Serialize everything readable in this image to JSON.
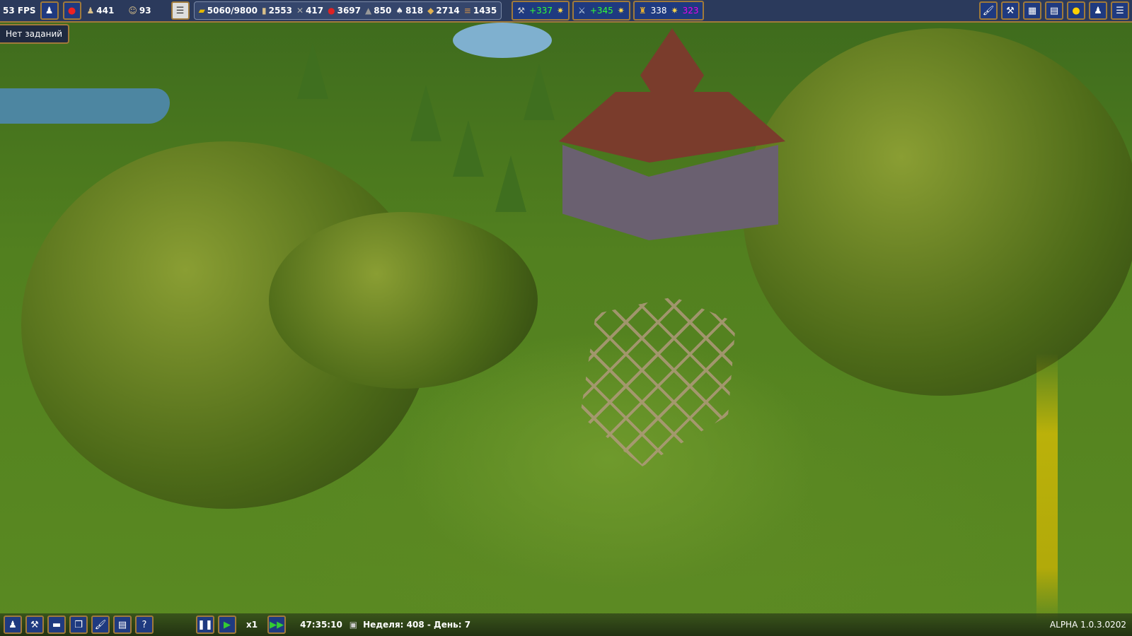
{
  "topbar": {
    "fps": "53 FPS",
    "population": "441",
    "happiness": "93",
    "resources": [
      {
        "icon": "gold-icon",
        "value": "5060/9800"
      },
      {
        "icon": "wood-icon",
        "value": "2553"
      },
      {
        "icon": "tools-icon",
        "value": "417"
      },
      {
        "icon": "berries-icon",
        "value": "3697"
      },
      {
        "icon": "stone-icon",
        "value": "850"
      },
      {
        "icon": "clothes-icon",
        "value": "818"
      },
      {
        "icon": "bread-icon",
        "value": "2714"
      },
      {
        "icon": "planks-icon",
        "value": "1435"
      }
    ],
    "bonuses": [
      {
        "icon": "hammer-icon",
        "value": "+337"
      },
      {
        "icon": "swords-icon",
        "value": "+345"
      },
      {
        "icon": "faith-icon",
        "value": "338",
        "extra": "323"
      }
    ]
  },
  "tasks": "Нет заданий",
  "bottombar": {
    "speed": "x1",
    "time": "47:35:10",
    "date": "Неделя: 408 - День: 7",
    "version": "ALPHA 1.0.3.0202"
  },
  "colors": {
    "bar": "#2b3a5c",
    "border": "#a07a3a",
    "button": "#1f3a80"
  }
}
